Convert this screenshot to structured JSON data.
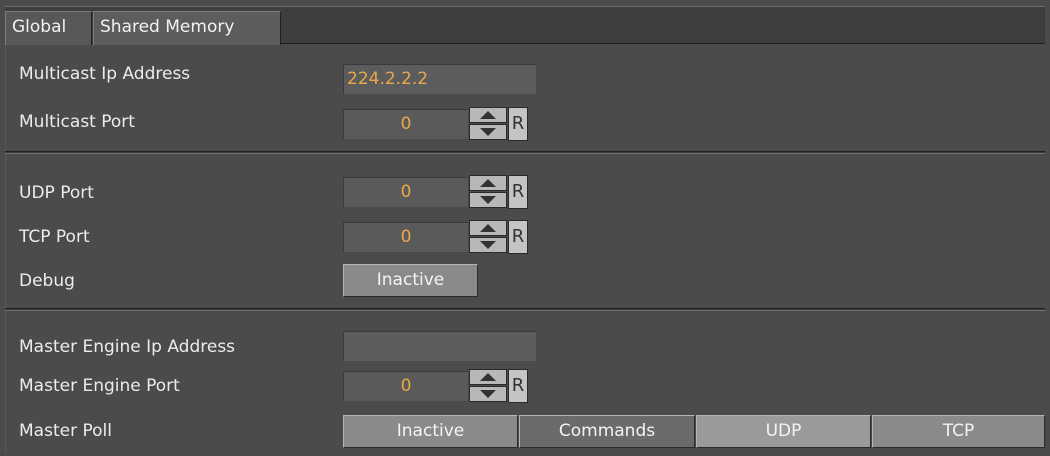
{
  "tabs": [
    {
      "label": "Global"
    },
    {
      "label": "Shared Memory"
    }
  ],
  "multicast": {
    "ip_label": "Multicast Ip Address",
    "ip_value": "224.2.2.2",
    "port_label": "Multicast Port",
    "port_value": "0"
  },
  "network": {
    "udp_label": "UDP Port",
    "udp_value": "0",
    "tcp_label": "TCP Port",
    "tcp_value": "0",
    "debug_label": "Debug",
    "debug_value": "Inactive"
  },
  "master": {
    "ip_label": "Master Engine Ip Address",
    "ip_value": "",
    "port_label": "Master Engine Port",
    "port_value": "0",
    "poll_label": "Master Poll",
    "poll_options": [
      "Inactive",
      "Commands",
      "UDP",
      "TCP"
    ],
    "poll_selected": "UDP"
  },
  "reset_label": "R",
  "colors": {
    "value_text": "#e9a84a",
    "background": "#4b4b4b"
  }
}
